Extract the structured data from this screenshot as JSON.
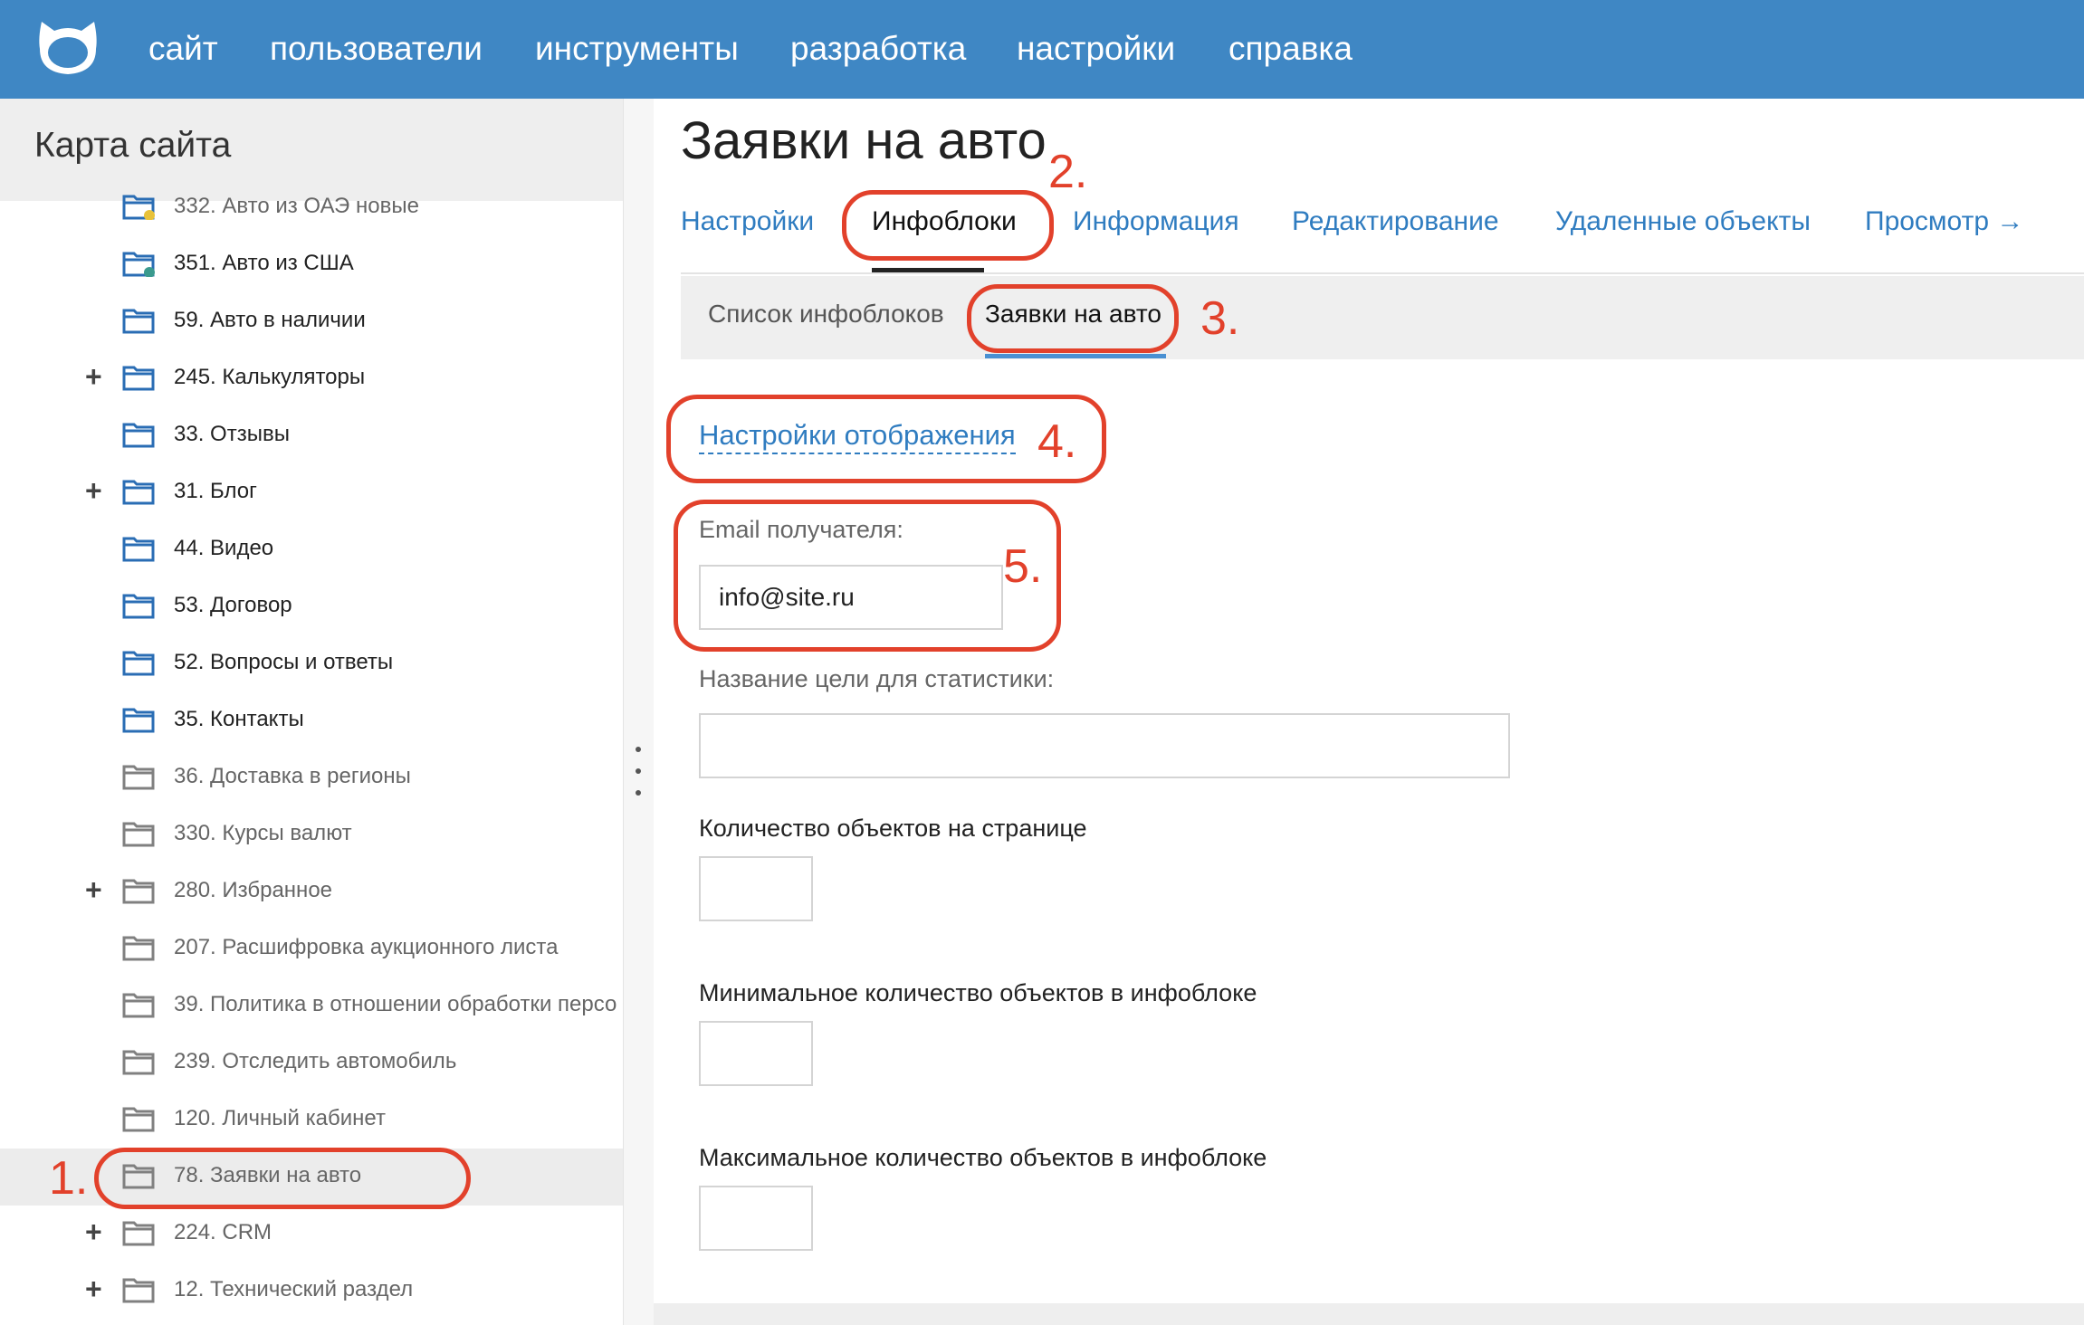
{
  "nav": {
    "items": [
      "сайт",
      "пользователи",
      "инструменты",
      "разработка",
      "настройки",
      "справка"
    ]
  },
  "sidebar": {
    "title": "Карта сайта",
    "items": [
      {
        "label": "332. Авто из ОАЭ новые",
        "style": "grey",
        "expand": false,
        "icon": "folder-yellow-dot"
      },
      {
        "label": "351. Авто из США",
        "style": "blue",
        "expand": false,
        "icon": "folder-teal-dot"
      },
      {
        "label": "59. Авто в наличии",
        "style": "blue",
        "expand": false,
        "icon": "folder"
      },
      {
        "label": "245. Калькуляторы",
        "style": "blue",
        "expand": true,
        "icon": "folder"
      },
      {
        "label": "33. Отзывы",
        "style": "blue",
        "expand": false,
        "icon": "folder"
      },
      {
        "label": "31. Блог",
        "style": "blue",
        "expand": true,
        "icon": "folder"
      },
      {
        "label": "44. Видео",
        "style": "blue",
        "expand": false,
        "icon": "folder"
      },
      {
        "label": "53. Договор",
        "style": "blue",
        "expand": false,
        "icon": "folder"
      },
      {
        "label": "52. Вопросы и ответы",
        "style": "blue",
        "expand": false,
        "icon": "folder"
      },
      {
        "label": "35. Контакты",
        "style": "blue",
        "expand": false,
        "icon": "folder"
      },
      {
        "label": "36. Доставка в регионы",
        "style": "grey",
        "expand": false,
        "icon": "folder"
      },
      {
        "label": "330. Курсы валют",
        "style": "grey",
        "expand": false,
        "icon": "folder"
      },
      {
        "label": "280. Избранное",
        "style": "grey",
        "expand": true,
        "icon": "folder"
      },
      {
        "label": "207. Расшифровка аукционного листа",
        "style": "grey",
        "expand": false,
        "icon": "folder"
      },
      {
        "label": "39. Политика в отношении обработки персо",
        "style": "grey",
        "expand": false,
        "icon": "folder"
      },
      {
        "label": "239. Отследить автомобиль",
        "style": "grey",
        "expand": false,
        "icon": "folder"
      },
      {
        "label": "120. Личный кабинет",
        "style": "grey",
        "expand": false,
        "icon": "folder"
      },
      {
        "label": "78. Заявки на авто",
        "style": "grey",
        "expand": false,
        "icon": "folder",
        "selected": true
      },
      {
        "label": "224. CRM",
        "style": "grey",
        "expand": true,
        "icon": "folder"
      },
      {
        "label": "12. Технический раздел",
        "style": "grey",
        "expand": true,
        "icon": "folder"
      }
    ]
  },
  "main": {
    "title": "Заявки на авто",
    "tabs": [
      "Настройки",
      "Инфоблоки",
      "Информация",
      "Редактирование",
      "Удаленные объекты",
      "Просмотр →"
    ],
    "active_tab": "Инфоблоки",
    "subtabs": [
      "Список инфоблоков",
      "Заявки на авто"
    ],
    "active_subtab": "Заявки на авто",
    "display_settings_link": "Настройки отображения",
    "fields": {
      "email_label": "Email получателя:",
      "email_value": "info@site.ru",
      "goal_label": "Название цели для статистики:",
      "goal_value": "",
      "per_page_label": "Количество объектов на странице",
      "per_page_value": "",
      "min_label": "Минимальное количество объектов в инфоблоке",
      "min_value": "",
      "max_label": "Максимальное количество объектов в инфоблоке",
      "max_value": ""
    }
  },
  "annotations": [
    "1.",
    "2.",
    "3.",
    "4.",
    "5."
  ],
  "colors": {
    "topbar": "#3f87c4",
    "link": "#2f7cc0",
    "annotation": "#e2412b",
    "folder_blue": "#2a6db4",
    "folder_grey": "#808080"
  }
}
